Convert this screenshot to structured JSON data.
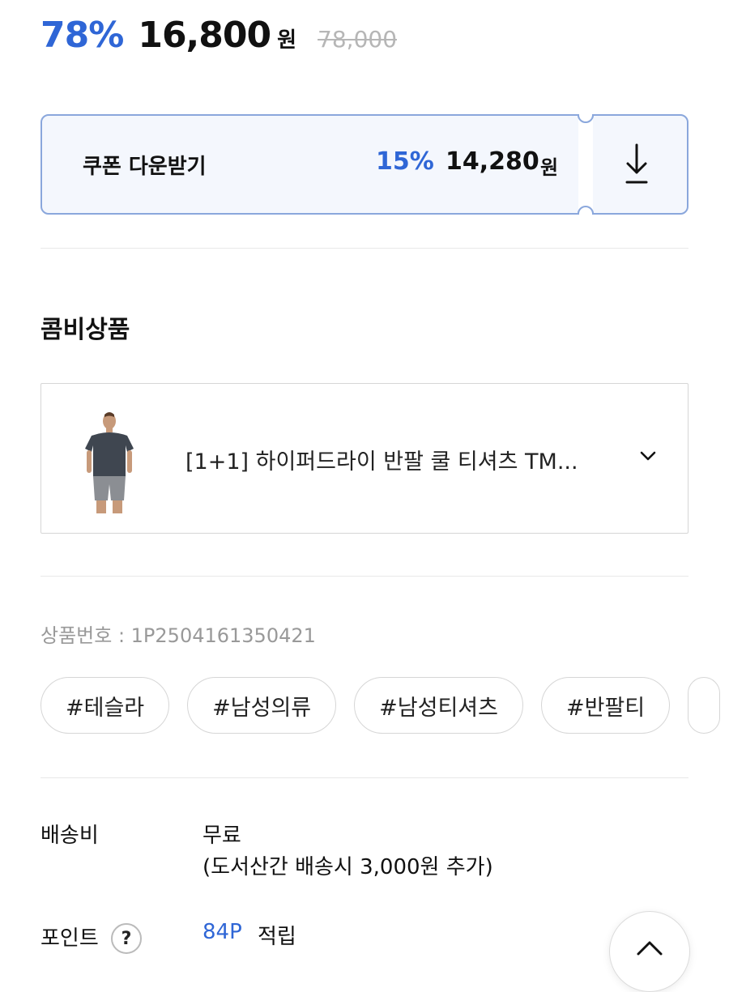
{
  "price": {
    "discount": "78%",
    "sale_price": "16,800",
    "currency": "원",
    "original_price": "78,000",
    "accent_color": "#2f66d6"
  },
  "coupon": {
    "label": "쿠폰 다운받기",
    "discount": "15%",
    "price": "14,280",
    "currency": "원",
    "icon": "download-icon"
  },
  "combo_section": {
    "title": "콤비상품",
    "product_name": "[1+1] 하이퍼드라이 반팔 쿨 티셔츠 TM...",
    "icon": "chevron-down-icon"
  },
  "product_number": "상품번호 : 1P2504161350421",
  "tags": [
    "#테슬라",
    "#남성의류",
    "#남성티셔츠",
    "#반팔티"
  ],
  "shipping": {
    "label": "배송비",
    "value": "무료",
    "note": "(도서산간 배송시 3,000원 추가)"
  },
  "points": {
    "label": "포인트",
    "help_icon": "?",
    "value": "84P",
    "suffix": "적립"
  },
  "scroll_top_icon": "chevron-up-icon"
}
